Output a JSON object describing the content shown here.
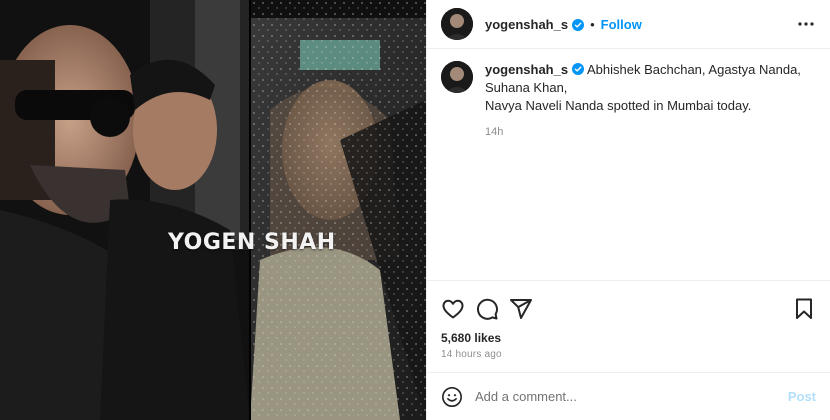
{
  "media": {
    "watermark": "YOGEN SHAH"
  },
  "header": {
    "username": "yogenshah_s",
    "verified_icon": "verified-badge-icon",
    "separator": "•",
    "follow_label": "Follow",
    "more_icon": "more-horizontal-icon"
  },
  "caption": {
    "username": "yogenshah_s",
    "line1": "Abhishek Bachchan, Agastya Nanda, Suhana Khan,",
    "line2": "Navya Naveli Nanda spotted in Mumbai today.",
    "time": "14h"
  },
  "actions": {
    "like_icon": "heart-icon",
    "comment_icon": "comment-icon",
    "share_icon": "share-icon",
    "save_icon": "bookmark-icon",
    "likes": "5,680 likes",
    "time_ago": "14 hours ago"
  },
  "add_comment": {
    "emoji_icon": "emoji-icon",
    "placeholder": "Add a comment...",
    "post_label": "Post"
  },
  "colors": {
    "link": "#0095f6",
    "post_disabled": "#b2dffc",
    "muted": "#8e8e8e",
    "border": "#efefef"
  }
}
